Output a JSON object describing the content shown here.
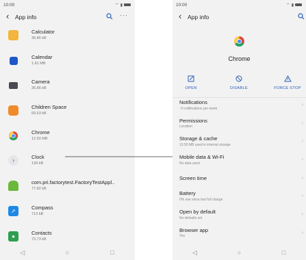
{
  "left": {
    "status": {
      "time": "10:00"
    },
    "header": {
      "title": "App info"
    },
    "apps": [
      {
        "name": "Calculator",
        "size": "36.86 kB",
        "color": "#f3b53d"
      },
      {
        "name": "Calendar",
        "size": "1.81 MB",
        "color": "#1f56c9"
      },
      {
        "name": "Camera",
        "size": "36.86 kB",
        "color": "#4a4a52"
      },
      {
        "name": "Children Space",
        "size": "69.63 kB",
        "color": "#f08a2a"
      },
      {
        "name": "Chrome",
        "size": "12.50 MB",
        "color": "#dd4b39"
      },
      {
        "name": "Clock",
        "size": "139 kB",
        "color": "#e6e6ea"
      },
      {
        "name": "com.pri.factorytest.FactoryTestAppl..",
        "size": "77.82 kB",
        "color": "#6bb83a"
      },
      {
        "name": "Compass",
        "size": "713 kB",
        "color": "#1e88e5"
      },
      {
        "name": "Contacts",
        "size": "73.73 kB",
        "color": "#2e9e4f"
      }
    ],
    "nav": {
      "back": "◁",
      "home": "○",
      "recent": "□"
    }
  },
  "right": {
    "status": {
      "time": "10:00"
    },
    "header": {
      "title": "App info"
    },
    "app": {
      "name": "Chrome"
    },
    "actions": [
      {
        "label": "OPEN",
        "icon": "open-icon"
      },
      {
        "label": "DISABLE",
        "icon": "disable-icon"
      },
      {
        "label": "FORCE STOP",
        "icon": "force-stop-icon"
      }
    ],
    "settings": [
      {
        "title": "Notifications",
        "subtitle": "~0 notifications per week"
      },
      {
        "title": "Permissions",
        "subtitle": "Location"
      },
      {
        "title": "Storage & cache",
        "subtitle": "13.50 MB used in internal storage"
      },
      {
        "title": "Mobile data & Wi-Fi",
        "subtitle": "No data used"
      },
      {
        "title": "Screen time",
        "subtitle": ""
      },
      {
        "title": "Battery",
        "subtitle": "0% use since last full charge"
      },
      {
        "title": "Open by default",
        "subtitle": "No defaults set"
      },
      {
        "title": "Browser app",
        "subtitle": "Yes"
      }
    ],
    "nav": {
      "back": "◁",
      "home": "○",
      "recent": "□"
    }
  },
  "colors": {
    "accent": "#2a5cb8"
  }
}
